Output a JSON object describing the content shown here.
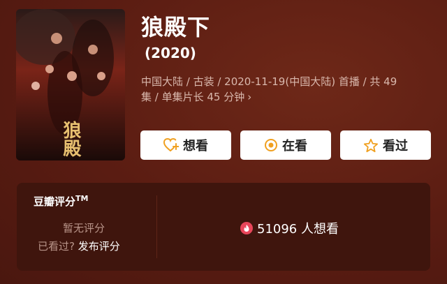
{
  "movie": {
    "title": "狼殿下",
    "year": "(2020)",
    "meta_line1": "中国大陆 / 古装 / 2020-11-19(中国大陆) 首播 / 共 49",
    "meta_line2": "集 / 单集片长 45 分钟",
    "poster_text": "狼殿"
  },
  "actions": {
    "want_label": "想看",
    "watching_label": "在看",
    "watched_label": "看过"
  },
  "rating": {
    "title": "豆瓣评分",
    "tm": "TM",
    "no_rating": "暂无评分",
    "seen_prefix": "已看过?",
    "publish_link": "发布评分",
    "want_count": "51096 人想看"
  },
  "colors": {
    "background": "#5a1c12",
    "panel": "#3f150d",
    "accent_orange": "#f0a020",
    "fire_red": "#e8465a"
  }
}
